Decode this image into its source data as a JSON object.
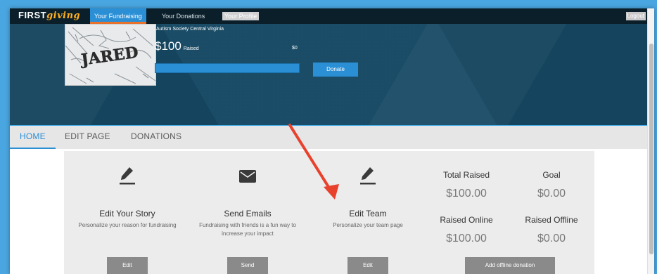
{
  "topnav": {
    "logo_first": "FIRST",
    "logo_giving": "giving",
    "items": [
      {
        "label": "Your Fundraising"
      },
      {
        "label": "Your Donations"
      },
      {
        "label": "Your Profile"
      }
    ],
    "logout": "Logout"
  },
  "campaign": {
    "organization": "Autism Society Central Virginia",
    "avatar_text": "JARED",
    "raised_amount": "$100",
    "raised_label": "Raised",
    "goal_amount": "$0",
    "progress_percent": 100,
    "donate_label": "Donate"
  },
  "tabs": [
    {
      "label": "HOME",
      "active": true
    },
    {
      "label": "EDIT PAGE",
      "active": false
    },
    {
      "label": "DONATIONS",
      "active": false
    }
  ],
  "cards": [
    {
      "icon": "pencil-icon",
      "title": "Edit Your Story",
      "desc": "Personalize your reason for fundraising",
      "button": "Edit"
    },
    {
      "icon": "envelope-icon",
      "title": "Send Emails",
      "desc": "Fundraising with friends is a fun way to increase your impact",
      "button": "Send"
    },
    {
      "icon": "pencil-icon",
      "title": "Edit Team",
      "desc": "Personalize your team page",
      "button": "Edit"
    }
  ],
  "stats": {
    "total_raised_label": "Total Raised",
    "total_raised_value": "$100.00",
    "goal_label": "Goal",
    "goal_value": "$0.00",
    "raised_online_label": "Raised Online",
    "raised_online_value": "$100.00",
    "raised_offline_label": "Raised Offline",
    "raised_offline_value": "$0.00",
    "offline_button": "Add offline donation"
  },
  "colors": {
    "accent": "#2b8fd6",
    "hero_bg": "#164964",
    "nav_bg": "#0b1f2a",
    "annotation_arrow": "#e8412c"
  }
}
